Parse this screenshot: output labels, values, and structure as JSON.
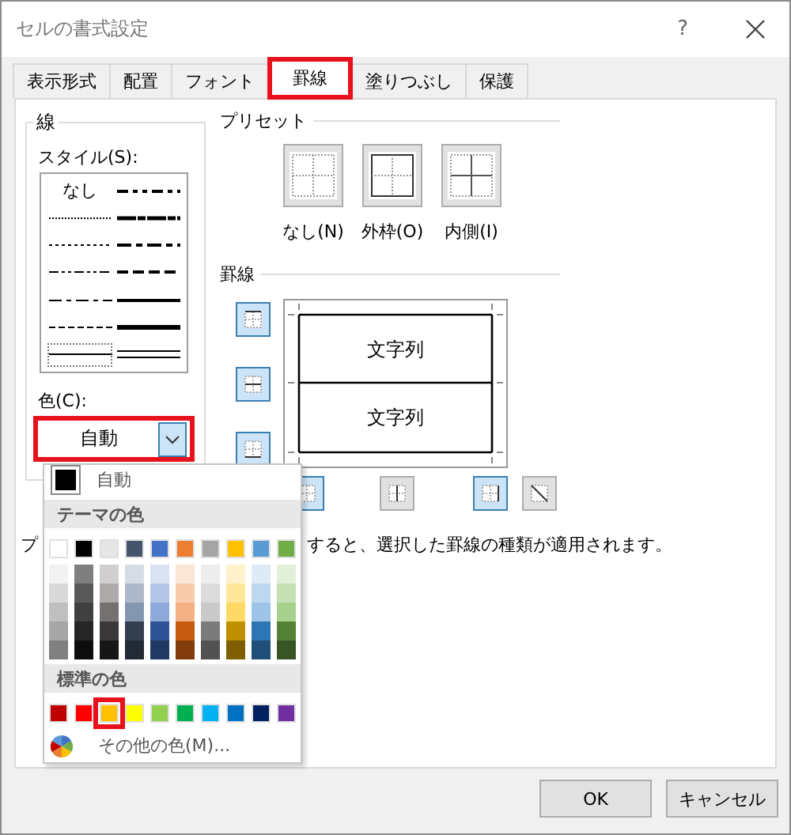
{
  "window": {
    "title": "セルの書式設定",
    "help": "?"
  },
  "tabs": [
    {
      "label": "表示形式",
      "selected": false,
      "highlighted": false
    },
    {
      "label": "配置",
      "selected": false,
      "highlighted": false
    },
    {
      "label": "フォント",
      "selected": false,
      "highlighted": false
    },
    {
      "label": "罫線",
      "selected": true,
      "highlighted": true
    },
    {
      "label": "塗りつぶし",
      "selected": false,
      "highlighted": false
    },
    {
      "label": "保護",
      "selected": false,
      "highlighted": false
    }
  ],
  "line": {
    "title": "線",
    "style_label": "スタイル(S):",
    "color_label": "色(C):",
    "color_value": "自動",
    "color_highlighted": true,
    "styles": [
      {
        "kind": "none",
        "label": "なし",
        "selected": false
      },
      {
        "kind": "hair",
        "selected": false
      },
      {
        "kind": "dotted",
        "selected": false
      },
      {
        "kind": "dash-dot-dot",
        "selected": false
      },
      {
        "kind": "dash-dot",
        "selected": false
      },
      {
        "kind": "dashed",
        "selected": false
      },
      {
        "kind": "thin",
        "selected": true
      },
      {
        "kind": "medium-dash-dot-dot",
        "selected": false
      },
      {
        "kind": "slant-dash-dot",
        "selected": false
      },
      {
        "kind": "medium-dash-dot",
        "selected": false
      },
      {
        "kind": "medium-dashed",
        "selected": false
      },
      {
        "kind": "medium",
        "selected": false
      },
      {
        "kind": "thick",
        "selected": false
      },
      {
        "kind": "double",
        "selected": false
      }
    ]
  },
  "presets": {
    "title": "プリセット",
    "items": [
      {
        "kind": "none",
        "label": "なし(N)"
      },
      {
        "kind": "outline",
        "label": "外枠(O)"
      },
      {
        "kind": "inside",
        "label": "内側(I)"
      }
    ]
  },
  "borders": {
    "title": "罫線",
    "preview_texts": [
      "文字列",
      "文字列"
    ],
    "side_buttons": [
      {
        "kind": "top",
        "on": true
      },
      {
        "kind": "middle-h",
        "on": true
      },
      {
        "kind": "bottom",
        "on": true
      }
    ],
    "bottom_buttons": [
      {
        "kind": "left",
        "on": true
      },
      {
        "kind": "middle-v",
        "on": false
      },
      {
        "kind": "right",
        "on": true
      },
      {
        "kind": "diagonal",
        "on": false
      }
    ]
  },
  "hint": [
    "プ",
    "すると、選択した罫線の種類が適用されます。"
  ],
  "color_menu": {
    "auto_label": "自動",
    "theme_title": "テーマの色",
    "standard_title": "標準の色",
    "more_label": "その他の色(M)...",
    "theme_colors": [
      {
        "color": "#ffffff",
        "selected": false,
        "shades": [
          {
            "color": "#f2f2f2",
            "selected": false
          },
          {
            "color": "#d9d9d9",
            "selected": false
          },
          {
            "color": "#bfbfbf",
            "selected": false
          },
          {
            "color": "#a6a6a6",
            "selected": false
          },
          {
            "color": "#808080",
            "selected": false
          }
        ]
      },
      {
        "color": "#000000",
        "selected": false,
        "shades": [
          {
            "color": "#7f7f7f",
            "selected": false
          },
          {
            "color": "#595959",
            "selected": false
          },
          {
            "color": "#404040",
            "selected": false
          },
          {
            "color": "#262626",
            "selected": false
          },
          {
            "color": "#0d0d0d",
            "selected": false
          }
        ]
      },
      {
        "color": "#e7e6e6",
        "selected": false,
        "shades": [
          {
            "color": "#d0cece",
            "selected": false
          },
          {
            "color": "#aeaaaa",
            "selected": false
          },
          {
            "color": "#757171",
            "selected": false
          },
          {
            "color": "#3a3838",
            "selected": false
          },
          {
            "color": "#171616",
            "selected": false
          }
        ]
      },
      {
        "color": "#44546a",
        "selected": false,
        "shades": [
          {
            "color": "#d6dce4",
            "selected": false
          },
          {
            "color": "#adb9ca",
            "selected": false
          },
          {
            "color": "#8497b0",
            "selected": false
          },
          {
            "color": "#333f4f",
            "selected": false
          },
          {
            "color": "#222a35",
            "selected": false
          }
        ]
      },
      {
        "color": "#4472c4",
        "selected": false,
        "shades": [
          {
            "color": "#d9e2f3",
            "selected": false
          },
          {
            "color": "#b4c6e7",
            "selected": false
          },
          {
            "color": "#8eaadb",
            "selected": false
          },
          {
            "color": "#2f5496",
            "selected": false
          },
          {
            "color": "#1f3864",
            "selected": false
          }
        ]
      },
      {
        "color": "#ed7d31",
        "selected": false,
        "shades": [
          {
            "color": "#fbe5d5",
            "selected": false
          },
          {
            "color": "#f7cbac",
            "selected": false
          },
          {
            "color": "#f4b183",
            "selected": false
          },
          {
            "color": "#c55a11",
            "selected": false
          },
          {
            "color": "#833c0b",
            "selected": false
          }
        ]
      },
      {
        "color": "#a5a5a5",
        "selected": false,
        "shades": [
          {
            "color": "#ededed",
            "selected": false
          },
          {
            "color": "#dbdbdb",
            "selected": false
          },
          {
            "color": "#c9c9c9",
            "selected": false
          },
          {
            "color": "#7b7b7b",
            "selected": false
          },
          {
            "color": "#525252",
            "selected": false
          }
        ]
      },
      {
        "color": "#ffc000",
        "selected": false,
        "shades": [
          {
            "color": "#fff2cc",
            "selected": false
          },
          {
            "color": "#ffe699",
            "selected": false
          },
          {
            "color": "#ffd966",
            "selected": false
          },
          {
            "color": "#bf9000",
            "selected": false
          },
          {
            "color": "#7f6000",
            "selected": false
          }
        ]
      },
      {
        "color": "#5b9bd5",
        "selected": false,
        "shades": [
          {
            "color": "#deebf6",
            "selected": false
          },
          {
            "color": "#bdd7ee",
            "selected": false
          },
          {
            "color": "#9dc3e6",
            "selected": false
          },
          {
            "color": "#2e75b5",
            "selected": false
          },
          {
            "color": "#1f4e79",
            "selected": false
          }
        ]
      },
      {
        "color": "#70ad47",
        "selected": false,
        "shades": [
          {
            "color": "#e2efd9",
            "selected": false
          },
          {
            "color": "#c5e0b3",
            "selected": false
          },
          {
            "color": "#a8d08d",
            "selected": false
          },
          {
            "color": "#538135",
            "selected": false
          },
          {
            "color": "#375623",
            "selected": false
          }
        ]
      }
    ],
    "standard_colors": [
      {
        "color": "#c00000",
        "selected": false
      },
      {
        "color": "#ff0000",
        "selected": false
      },
      {
        "color": "#ffc000",
        "selected": true
      },
      {
        "color": "#ffff00",
        "selected": false
      },
      {
        "color": "#92d050",
        "selected": false
      },
      {
        "color": "#00b050",
        "selected": false
      },
      {
        "color": "#00b0f0",
        "selected": false
      },
      {
        "color": "#0070c0",
        "selected": false
      },
      {
        "color": "#002060",
        "selected": false
      },
      {
        "color": "#7030a0",
        "selected": false
      }
    ]
  },
  "buttons": [
    "OK",
    "キャンセル"
  ]
}
